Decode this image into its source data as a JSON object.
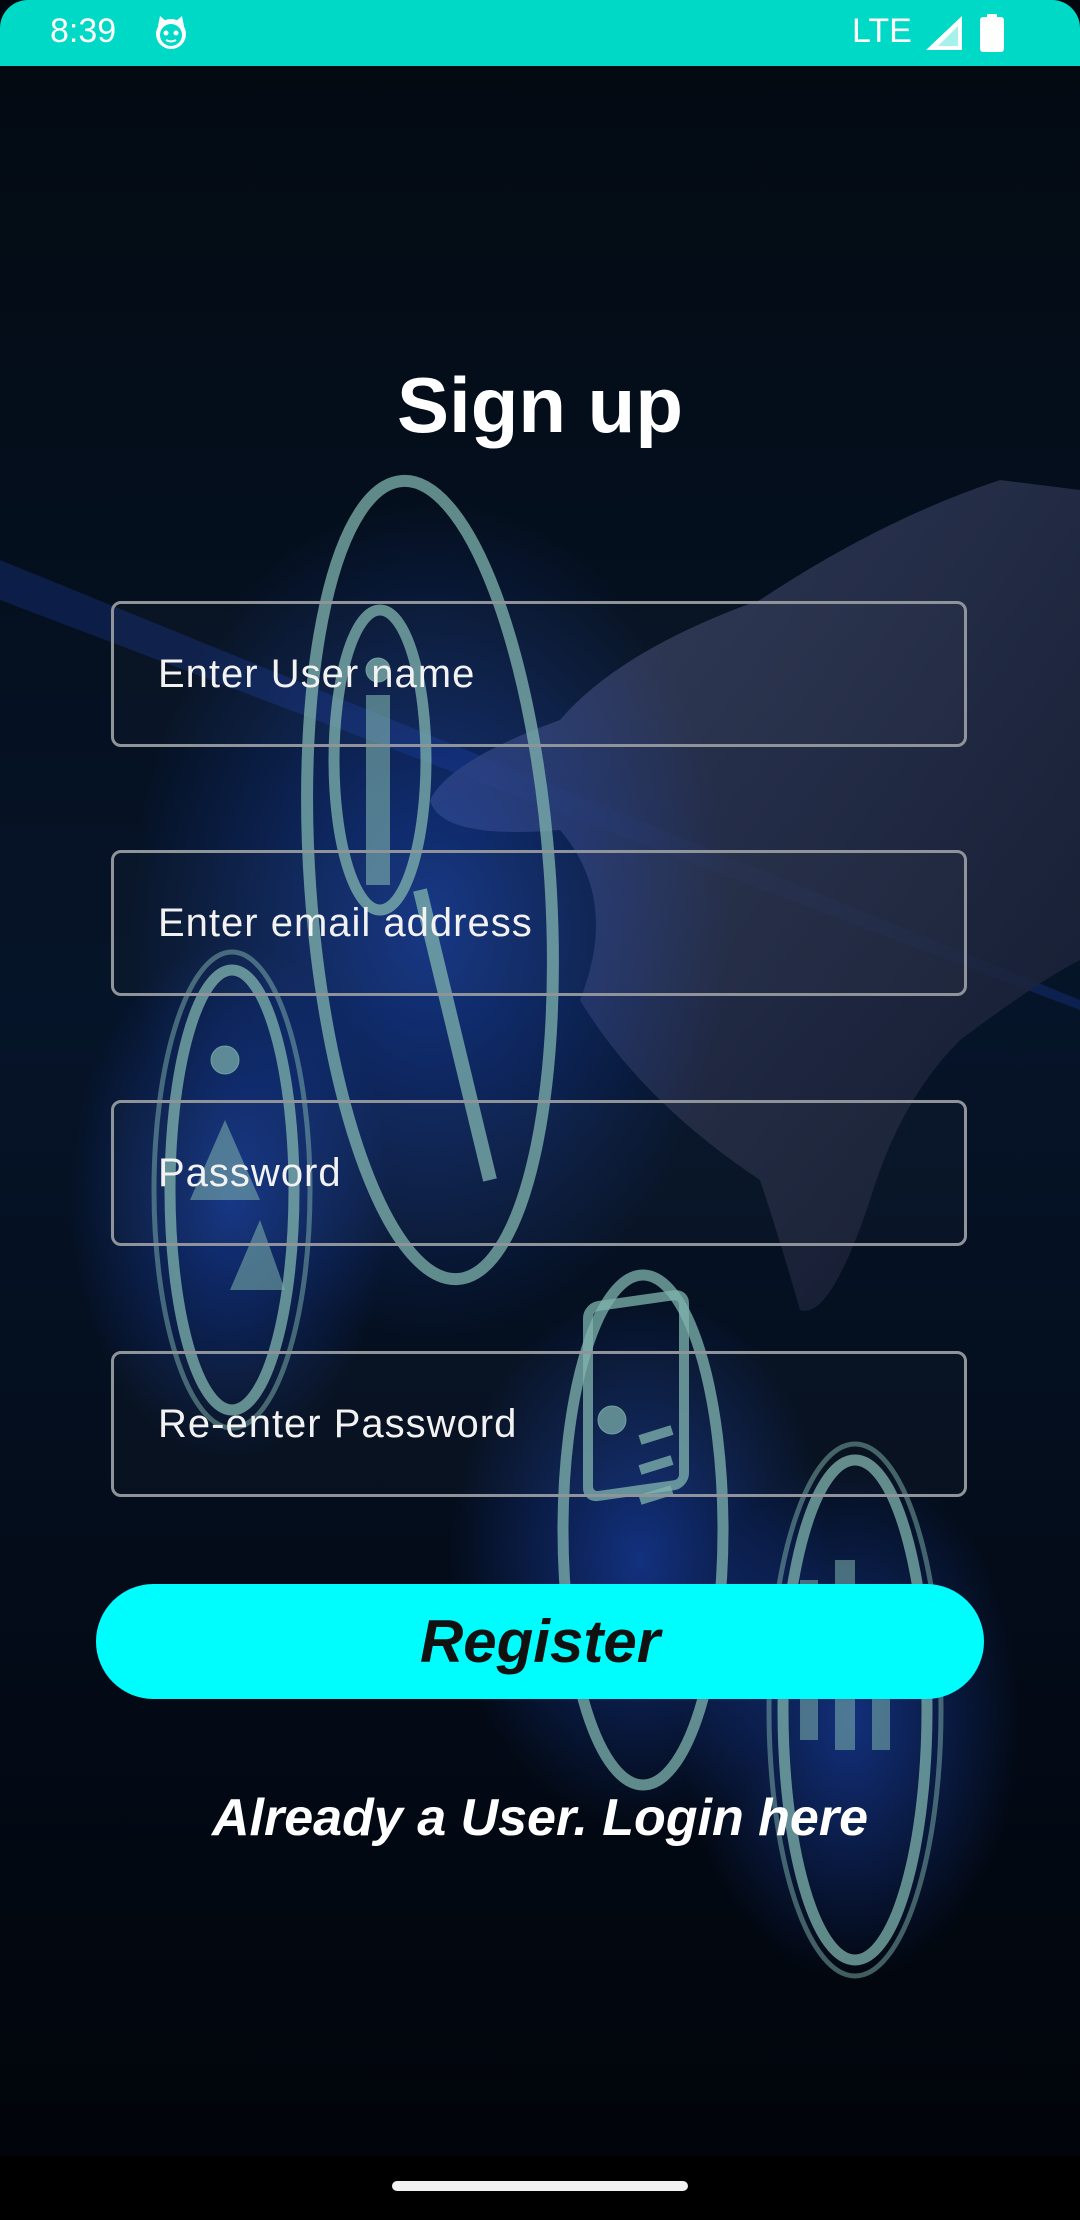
{
  "status_bar": {
    "time": "8:39",
    "network": "LTE",
    "icons": [
      "cat-face-icon",
      "signal-icon",
      "battery-icon"
    ],
    "color": "#00d9c5"
  },
  "background": {
    "description_icons": [
      "magnifier-person-icon",
      "people-network-icon",
      "id-card-icon",
      "group-icon",
      "hand-icon"
    ],
    "glow_color": "#3a6cff"
  },
  "form": {
    "title": "Sign up",
    "username_placeholder": "Enter User name",
    "email_placeholder": "Enter email address",
    "password_placeholder": "Password",
    "reenter_password_placeholder": "Re-enter Password",
    "register_label": "Register",
    "login_link": "Already a User. Login here"
  },
  "colors": {
    "accent": "#00fdfd",
    "field_border": "#8f949b",
    "text": "#ffffff"
  }
}
